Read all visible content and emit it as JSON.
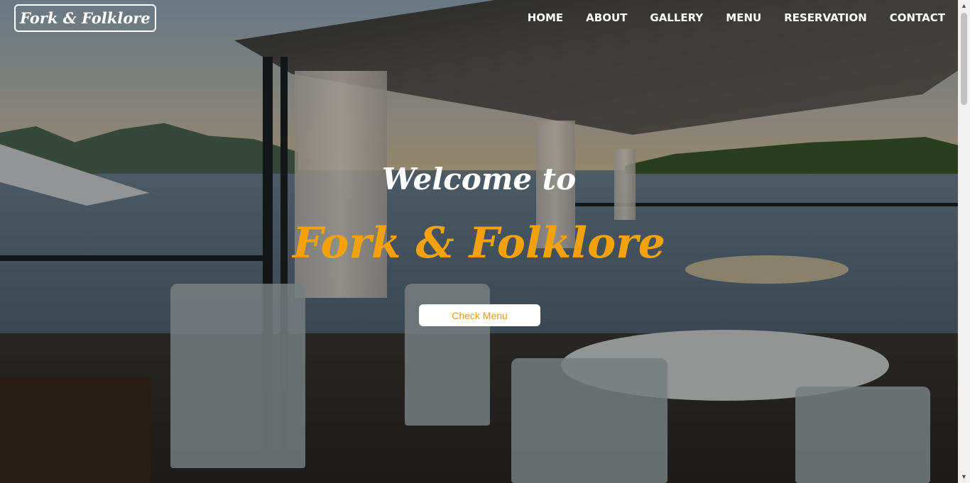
{
  "brand": {
    "logo_text": "Fork & Folklore"
  },
  "nav": {
    "items": [
      "HOME",
      "ABOUT",
      "GALLERY",
      "MENU",
      "RESERVATION",
      "CONTACT"
    ]
  },
  "hero": {
    "welcome": "Welcome to",
    "title": "Fork & Folklore",
    "cta_label": "Check Menu"
  },
  "colors": {
    "accent": "#f3a20e",
    "button_text": "#e79a10"
  },
  "icons": {
    "scroll_up": "triangle-up-icon",
    "scroll_down": "triangle-down-icon"
  }
}
